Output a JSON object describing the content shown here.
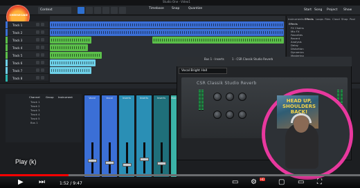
{
  "window": {
    "title": "Studio One - Video1"
  },
  "toolbar": {
    "song_label": "Context",
    "menu": [
      "Start",
      "Song",
      "Project",
      "Show"
    ],
    "transport_labels": [
      "Timebase",
      "Snap",
      "Quantize"
    ]
  },
  "logo": {
    "text": "CHEESECAKE"
  },
  "tracks": [
    {
      "name": "Track 1",
      "color": "#3b6fd6"
    },
    {
      "name": "Track 2",
      "color": "#3b6fd6"
    },
    {
      "name": "Track 3",
      "color": "#5bbf4a"
    },
    {
      "name": "Track 4",
      "color": "#5bbf4a"
    },
    {
      "name": "Track 5",
      "color": "#5bbf4a"
    },
    {
      "name": "Track 6",
      "color": "#6fd0e8"
    },
    {
      "name": "Track 7",
      "color": "#6fd0e8"
    },
    {
      "name": "Track 8",
      "color": "#2bb7b0"
    }
  ],
  "browser": {
    "tabs": [
      "Instruments",
      "Effects",
      "Loops",
      "Files",
      "Cloud",
      "Shop",
      "Pool"
    ],
    "items": [
      "Effects",
      "FX Chains",
      "Mix FX",
      "Favorites",
      "Recent",
      "Analysis",
      "Delay",
      "Distortion",
      "Dynamics",
      "Mastering",
      "Mixing",
      "Modulation",
      "Reverb"
    ]
  },
  "console": {
    "headers": [
      "Channel",
      "Group",
      "Instrument"
    ],
    "rows": [
      "Track 1",
      "Track 2",
      "Track 3",
      "Track 4",
      "Track 5",
      "Bus 1"
    ]
  },
  "mixer": {
    "strips": [
      {
        "label": "Vocal",
        "color": "#3b6fd6"
      },
      {
        "label": "Vocal",
        "color": "#3b6fd6"
      },
      {
        "label": "Inserts",
        "color": "#2a8fb5"
      },
      {
        "label": "Inserts",
        "color": "#2a8fb5"
      },
      {
        "label": "Inserts",
        "color": "#1f6f7a"
      },
      {
        "label": "Main",
        "color": "#3bb3a8"
      }
    ]
  },
  "plugin": {
    "header": "Bus 1 - Inserts",
    "slot": "1 - CSR Classik Studio Reverb",
    "preset": "Vocal Bright Hall",
    "panel_title": "CSR Classik Studio Reverb",
    "knobs": [
      "Mix",
      "Pre-Delay",
      "Decay",
      "Size",
      "Damping",
      "Width"
    ]
  },
  "webcam": {
    "poster_text": "HEAD UP, SHOULDERS BACK!"
  },
  "player": {
    "tooltip": "Play (k)",
    "progress": 0.19,
    "time": "1:52 / 9:47",
    "hd_label": "HD"
  }
}
